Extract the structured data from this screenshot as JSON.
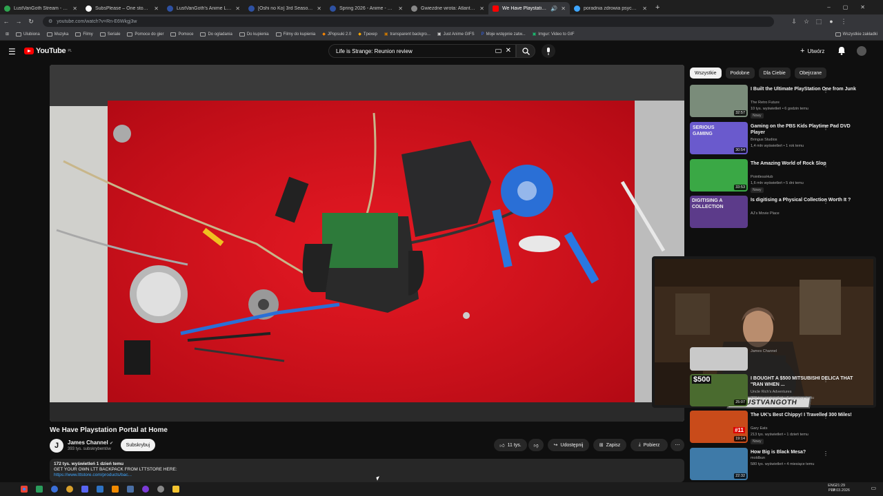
{
  "browser": {
    "tabs": [
      {
        "label": "LustVanGoth Stream - Watch Li",
        "color": "#2ea44f"
      },
      {
        "label": "SubsPlease – One stop shop fo",
        "color": "#ffffff"
      },
      {
        "label": "LustVanGoth's Anime List - My",
        "color": "#2e51a2"
      },
      {
        "label": "[Oshi no Ko] 3rd Season ([Oshi",
        "color": "#2e51a2"
      },
      {
        "label": "Spring 2026 - Anime - MyAnim",
        "color": "#2e51a2"
      },
      {
        "label": "Gwiezdne wrota: Atlantyda / Sz",
        "color": "#888888"
      },
      {
        "label": "We Have Playstation Portal",
        "color": "#ff0000",
        "active": true
      },
      {
        "label": "poradnia zdrowia psychicznego",
        "color": "#3ea6ff"
      }
    ],
    "url": "youtube.com/watch?v=Rn-E6Wkgj3w",
    "bookmarks": [
      "Ulubiona",
      "Muzyka",
      "Filmy",
      "Seriale",
      "Pomoce do gier",
      "Pomoce",
      "Do ogladania",
      "Do kupienia",
      "Filmy do kupienia",
      "JPopsuki 2.0",
      "Tpexep",
      "transparent backgro...",
      "Just Anime GIFS",
      "Moje wstępnie zatw...",
      "Imgur: Video to GIF"
    ],
    "all_bookmarks": "Wszystkie zakładki"
  },
  "youtube": {
    "logo_text": "YouTube",
    "logo_region": "PL",
    "search_value": "Life is Strange: Reunion review",
    "create_label": "Utwórz",
    "video": {
      "title": "We Have Playstation Portal at Home",
      "channel": "James Channel",
      "subscribers": "393 tys. subskrybentów",
      "subscribe_label": "Subskrybuj",
      "likes": "11 tys.",
      "share_label": "Udostępnij",
      "save_label": "Zapisz",
      "download_label": "Pobierz",
      "views_date": "172 tys. wyświetleń  1 dzień temu",
      "desc_line": "GET YOUR OWN LTT BACKPACK FROM LTTSTORE HERE:",
      "desc_link": "https://www.lttstore.com/products/bac..."
    },
    "chips": [
      "Wszystkie",
      "Podobne",
      "Dla Ciebie",
      "Obejrzane"
    ],
    "recommendations": [
      {
        "title": "I Built the Ultimate PlayStation One from Junk",
        "channel": "The Retro Future",
        "views": "10 tys. wyświetleń • 6 godzin temu",
        "badge": "Nowy",
        "duration": "32:57",
        "thumb_color": "#7a8c7a"
      },
      {
        "title": "Gaming on the PBS Kids Playtime Pad DVD Player",
        "channel": "Bringus Studios",
        "views": "1,4 mln wyświetleń • 1 rok temu",
        "badge": "",
        "duration": "30:54",
        "thumb_color": "#6a5acd",
        "thumb_text": "SERIOUS GAMING"
      },
      {
        "title": "The Amazing World of Rock Slop",
        "channel": "PointlessHub",
        "views": "1,6 mln wyświetleń • 5 dni temu",
        "badge": "Nowy",
        "duration": "33:53",
        "thumb_color": "#3aa845"
      },
      {
        "title": "Is digitising a Physical Collection Worth It ?",
        "channel": "AJ's Movie Place",
        "views": "",
        "badge": "",
        "duration": "",
        "thumb_color": "#5c3b8a",
        "thumb_text": "DIGITISING A COLLECTION"
      },
      {
        "title": "",
        "channel": "James Channel",
        "views": "",
        "badge": "",
        "duration": "",
        "thumb_color": "#c9c9c9"
      },
      {
        "title": "I BOUGHT A $500 MITSUBISHI DELICA THAT \"RAN WHEN ...",
        "channel": "Uncle Rich's Adventures",
        "views": "208 tys. wyświetleń • 6 miesięcy temu",
        "badge": "",
        "duration": "25:07",
        "thumb_color": "#4a6b2f",
        "thumb_text": "$500"
      },
      {
        "title": "The UK's Best Chippy! I Travelled 300 Miles!",
        "channel": "Gary Eats",
        "views": "213 tys. wyświetleń • 1 dzień temu",
        "badge": "Nowy",
        "duration": "19:14",
        "thumb_color": "#c94b1a",
        "thumb_text": "#11"
      },
      {
        "title": "How Big is Black Mesa?",
        "channel": "moldbun",
        "views": "580 tys. wyświetleń • 4 miesiące temu",
        "badge": "",
        "duration": "22:32",
        "thumb_color": "#3e7aa8"
      }
    ],
    "overlay_banner": "LUSTVANGOTH"
  },
  "taskbar": {
    "lang": "ENG",
    "lang2": "PLP",
    "time": "21:29",
    "date": "28.03.2026"
  }
}
